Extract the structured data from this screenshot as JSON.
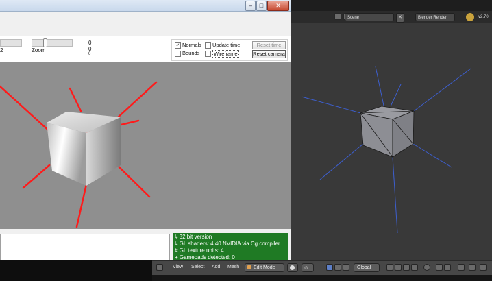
{
  "left_app": {
    "window_buttons": [
      "–",
      "□",
      "✕"
    ],
    "slider_label": "Zoom",
    "slider_side_label": "2",
    "values": [
      "0",
      "0",
      "0"
    ],
    "checkboxes": [
      {
        "label": "Normals",
        "checked": true
      },
      {
        "label": "Update time",
        "checked": false
      },
      {
        "label": "Bounds",
        "checked": false
      },
      {
        "label": "Wireframe",
        "checked": false
      }
    ],
    "buttons": {
      "reset_time": "Reset time",
      "reset_camera": "Reset camera"
    },
    "console_lines": [
      "# 32 bit version",
      "# GL shaders: 4.40 NVIDIA via Cg compiler",
      "# GL texture units: 4",
      "+ Gamepads detected: 0"
    ],
    "colors": {
      "normals": "#ff1a1a",
      "console_bg": "#1f7a24"
    }
  },
  "blender": {
    "scene_field": "Scene",
    "render_engine": "Blender Render",
    "version": "v2.70",
    "footer_menus": [
      "View",
      "Select",
      "Add",
      "Mesh"
    ],
    "mode": "Edit Mode",
    "pivot": "Global",
    "colors": {
      "normals": "#3d5fcf",
      "bg": "#393939"
    }
  }
}
